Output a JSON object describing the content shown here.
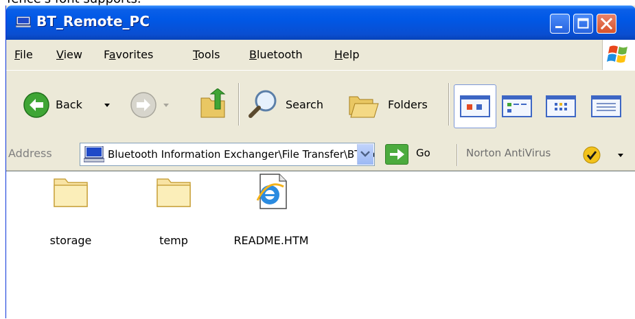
{
  "top_fragment": "fence's font supports.",
  "window": {
    "title": "BT_Remote_PC"
  },
  "menu": {
    "items": [
      {
        "label": "File",
        "accel": "F",
        "rest": "ile"
      },
      {
        "label": "View",
        "accel": "V",
        "rest": "iew"
      },
      {
        "label": "Favorites",
        "pre": "F",
        "accel": "a",
        "rest": "vorites"
      },
      {
        "label": "Tools",
        "accel": "T",
        "rest": "ools"
      },
      {
        "label": "Bluetooth",
        "accel": "B",
        "rest": "luetooth"
      },
      {
        "label": "Help",
        "accel": "H",
        "rest": "elp"
      }
    ]
  },
  "toolbar": {
    "back_label": "Back",
    "search_label": "Search",
    "folders_label": "Folders"
  },
  "address": {
    "label": "Address",
    "value": "Bluetooth Information Exchanger\\File Transfer\\BT_Remote_PC",
    "go_label": "Go",
    "norton_label": "Norton AntiVirus"
  },
  "files": [
    {
      "name": "storage",
      "type": "folder"
    },
    {
      "name": "temp",
      "type": "folder"
    },
    {
      "name": "README.HTM",
      "type": "html"
    }
  ],
  "colors": {
    "titlebar": "#0058e6",
    "chrome": "#ece9d8",
    "close_button": "#d9532a",
    "go_button": "#4cab3e"
  }
}
